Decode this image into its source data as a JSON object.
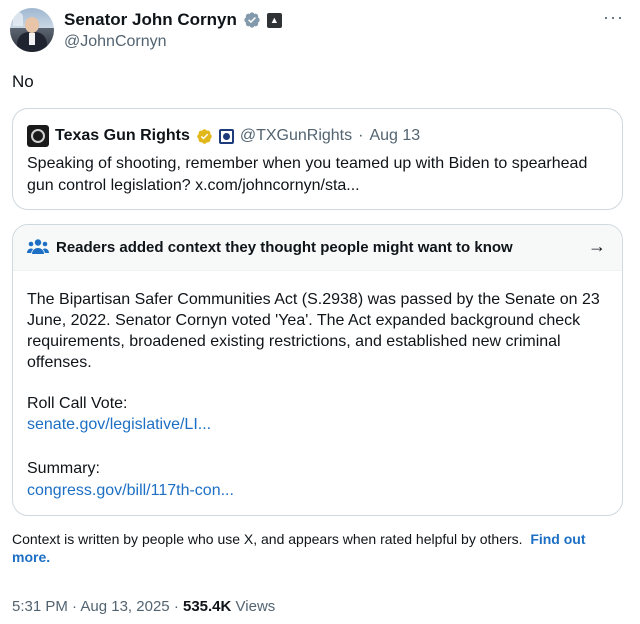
{
  "author": {
    "display_name": "Senator John Cornyn",
    "handle": "@JohnCornyn",
    "verified_color": "#829aab",
    "badge_icon": "government-badge-icon"
  },
  "more_label": "···",
  "tweet": {
    "text": "No"
  },
  "quoted": {
    "display_name": "Texas Gun Rights",
    "verified_color": "#e2b719",
    "handle": "@TXGunRights",
    "separator": "·",
    "date": "Aug 13",
    "text": "Speaking of shooting, remember when you teamed up with Biden to spearhead gun control legislation? x.com/johncornyn/sta..."
  },
  "community_note": {
    "title": "Readers added context they thought people might want to know",
    "arrow": "→",
    "body": "The Bipartisan Safer Communities Act (S.2938) was passed by the Senate on 23 June, 2022. Senator Cornyn voted 'Yea'. The Act expanded background check requirements, broadened existing restrictions, and established new criminal offenses.",
    "sources": [
      {
        "label": "Roll Call Vote:",
        "link": "senate.gov/legislative/LI..."
      },
      {
        "label": "Summary:",
        "link": "congress.gov/bill/117th-con..."
      }
    ],
    "icon_color": "#1d6fc4"
  },
  "context_note": {
    "text": "Context is written by people who use X, and appears when rated helpful by others.",
    "link": "Find out more."
  },
  "footer": {
    "time": "5:31 PM",
    "sep1": "·",
    "date": "Aug 13, 2025",
    "sep2": "·",
    "views_count": "535.4K",
    "views_label": "Views"
  }
}
